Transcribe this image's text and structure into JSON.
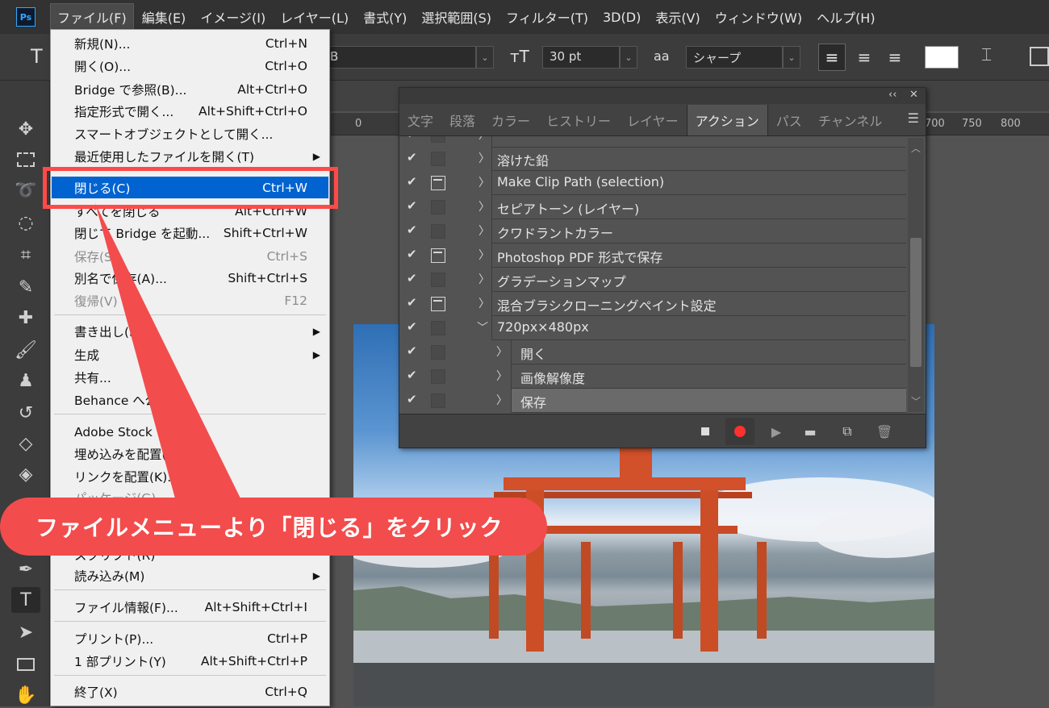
{
  "menubar": {
    "logo": "Ps",
    "items": [
      "ファイル(F)",
      "編集(E)",
      "イメージ(I)",
      "レイヤー(L)",
      "書式(Y)",
      "選択範囲(S)",
      "フィルター(T)",
      "3D(D)",
      "表示(V)",
      "ウィンドウ(W)",
      "ヘルプ(H)"
    ]
  },
  "options": {
    "font_style": "B",
    "size": "30 pt",
    "antialias_label": "aa",
    "antialias": "シャープ"
  },
  "ruler": {
    "ticks": [
      "0",
      "700",
      "750",
      "800"
    ]
  },
  "file_menu": {
    "rows": [
      {
        "label": "新規(N)...",
        "shortcut": "Ctrl+N"
      },
      {
        "label": "開く(O)...",
        "shortcut": "Ctrl+O"
      },
      {
        "label": "Bridge で参照(B)...",
        "shortcut": "Alt+Ctrl+O"
      },
      {
        "label": "指定形式で開く...",
        "shortcut": "Alt+Shift+Ctrl+O"
      },
      {
        "label": "スマートオブジェクトとして開く...",
        "shortcut": ""
      },
      {
        "label": "最近使用したファイルを開く(T)",
        "shortcut": ""
      },
      {
        "label": "閉じる(C)",
        "shortcut": "Ctrl+W"
      },
      {
        "label": "すべてを閉じる",
        "shortcut": "Alt+Ctrl+W"
      },
      {
        "label": "閉じて Bridge を起動...",
        "shortcut": "Shift+Ctrl+W"
      },
      {
        "label": "保存(S)",
        "shortcut": "Ctrl+S"
      },
      {
        "label": "別名で保存(A)...",
        "shortcut": "Shift+Ctrl+S"
      },
      {
        "label": "復帰(V)",
        "shortcut": "F12"
      },
      {
        "label": "書き出し(E)",
        "shortcut": ""
      },
      {
        "label": "生成",
        "shortcut": ""
      },
      {
        "label": "共有...",
        "shortcut": ""
      },
      {
        "label": "Behance へ公開...",
        "shortcut": ""
      },
      {
        "label": "Adobe Stock を検索...",
        "shortcut": ""
      },
      {
        "label": "埋め込みを配置(L)...",
        "shortcut": ""
      },
      {
        "label": "リンクを配置(K)...",
        "shortcut": ""
      },
      {
        "label": "パッケージ(G)...",
        "shortcut": ""
      },
      {
        "label": "スクリプト(R)",
        "shortcut": ""
      },
      {
        "label": "読み込み(M)",
        "shortcut": ""
      },
      {
        "label": "ファイル情報(F)...",
        "shortcut": "Alt+Shift+Ctrl+I"
      },
      {
        "label": "プリント(P)...",
        "shortcut": "Ctrl+P"
      },
      {
        "label": "1 部プリント(Y)",
        "shortcut": "Alt+Shift+Ctrl+P"
      },
      {
        "label": "終了(X)",
        "shortcut": "Ctrl+Q"
      }
    ]
  },
  "callout": "ファイルメニューより「閉じる」をクリック",
  "panel": {
    "top_buttons": [
      "‹‹",
      "✕"
    ],
    "tabs": [
      "文字",
      "段落",
      "カラー",
      "ヒストリー",
      "レイヤー",
      "アクション",
      "パス",
      "チャンネル"
    ],
    "actions": [
      {
        "name": "溶けた鉛"
      },
      {
        "name": "Make Clip Path (selection)"
      },
      {
        "name": "セピアトーン (レイヤー)"
      },
      {
        "name": "クワドラントカラー"
      },
      {
        "name": "Photoshop PDF 形式で保存"
      },
      {
        "name": "グラデーションマップ"
      },
      {
        "name": "混合ブラシクローニングペイント設定"
      },
      {
        "name": "720px×480px"
      },
      {
        "name": "開く"
      },
      {
        "name": "画像解像度"
      },
      {
        "name": "保存"
      }
    ]
  },
  "colors": {
    "menu_highlight": "#0063d0",
    "callout_bg": "#f24c4c",
    "record_button": "#ff3030"
  }
}
